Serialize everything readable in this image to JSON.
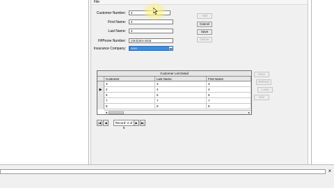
{
  "menu": {
    "file_label": "File"
  },
  "form": {
    "customer_number": {
      "label": "Customer Number:",
      "value": "4"
    },
    "first_name": {
      "label": "First Name:",
      "value": "4"
    },
    "last_name": {
      "label": "Last Name:",
      "value": "4"
    },
    "phone": {
      "label": "H/Phone Number:",
      "value": "(444)444-4444"
    },
    "insurance": {
      "label": "Insurance Company:",
      "value": "AAA"
    }
  },
  "buttons": {
    "add": "Add",
    "cancel": "Cancel",
    "save": "Save",
    "delete": "Delete"
  },
  "grid": {
    "caption": "Customer List Detail",
    "columns": [
      "Customer",
      "Last Name",
      "First Name"
    ],
    "rows": [
      [
        "3",
        "3",
        "3"
      ],
      [
        "4",
        "4",
        "4"
      ],
      [
        "5",
        "5",
        "5"
      ],
      [
        "7",
        "7",
        "7"
      ],
      [
        "8",
        "8",
        "8"
      ]
    ],
    "current_row_index": 1
  },
  "side_buttons": {
    "b1": "Save",
    "b2": "Refresh",
    "b3": "Load",
    "b4": "Exit"
  },
  "navigator": {
    "first": "|◀",
    "prev": "◀",
    "text": "Record: 2 of 5",
    "next": "▶",
    "last": "▶|"
  },
  "bottom": {
    "close_glyph": "×"
  },
  "colors": {
    "accent_selection": "#3b8ee0",
    "highlight": "#fff58c"
  }
}
